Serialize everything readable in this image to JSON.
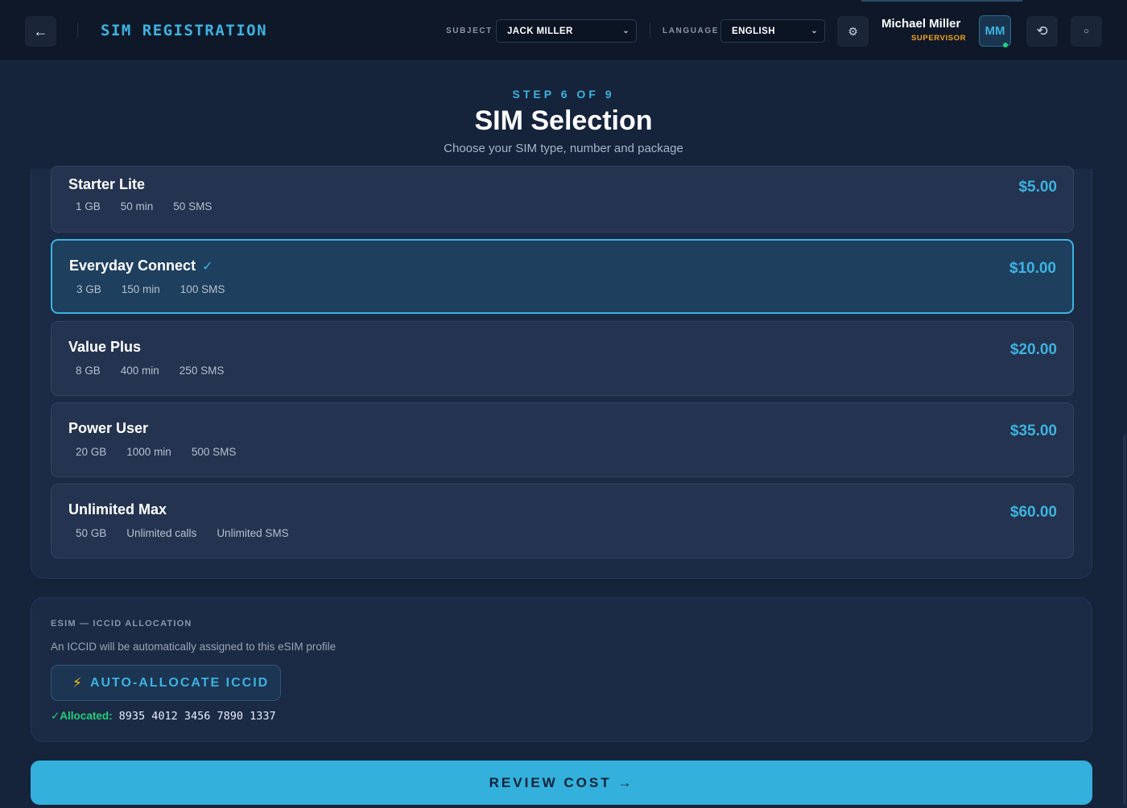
{
  "header": {
    "back_icon": "←",
    "title": "SIM REGISTRATION",
    "subject_label": "SUBJECT",
    "subject_value": "JACK MILLER",
    "language_label": "LANGUAGE",
    "language_value": "ENGLISH",
    "settings_icon": "⚙",
    "user_name": "Michael Miller",
    "user_role": "SUPERVISOR",
    "avatar_initials": "MM",
    "history_icon": "⟲",
    "more_icon": "○"
  },
  "step": {
    "label": "STEP 6 OF 9",
    "title": "SIM Selection",
    "subtitle": "Choose your SIM type, number and package"
  },
  "packages": [
    {
      "name": "Starter Lite",
      "specs": [
        "1 GB",
        "50 min",
        "50 SMS"
      ],
      "price": "$5.00",
      "selected": false
    },
    {
      "name": "Everyday Connect",
      "check": "✓",
      "specs": [
        "3 GB",
        "150 min",
        "100 SMS"
      ],
      "price": "$10.00",
      "selected": true
    },
    {
      "name": "Value Plus",
      "specs": [
        "8 GB",
        "400 min",
        "250 SMS"
      ],
      "price": "$20.00",
      "selected": false
    },
    {
      "name": "Power User",
      "specs": [
        "20 GB",
        "1000 min",
        "500 SMS"
      ],
      "price": "$35.00",
      "selected": false
    },
    {
      "name": "Unlimited Max",
      "specs": [
        "50 GB",
        "Unlimited calls",
        "Unlimited SMS"
      ],
      "price": "$60.00",
      "selected": false
    }
  ],
  "esim": {
    "title": "ESIM — ICCID ALLOCATION",
    "description": "An ICCID will be automatically assigned to this eSIM profile",
    "button_icon": "⚡",
    "button_label": "AUTO-ALLOCATE ICCID",
    "status_label": "✓Allocated:",
    "iccid": "8935 4012 3456 7890 1337"
  },
  "footer": {
    "review_label": "REVIEW COST →"
  },
  "colors": {
    "accent": "#3db3e0",
    "success": "#22d07a",
    "warning": "#f2a51a",
    "background": "#15233b"
  }
}
